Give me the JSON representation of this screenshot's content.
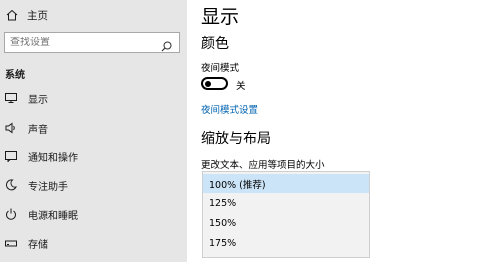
{
  "sidebar": {
    "home_label": "主页",
    "search_placeholder": "查找设置",
    "section_label": "系统",
    "items": [
      {
        "label": "显示",
        "icon": "monitor-icon"
      },
      {
        "label": "声音",
        "icon": "speaker-icon"
      },
      {
        "label": "通知和操作",
        "icon": "notification-icon"
      },
      {
        "label": "专注助手",
        "icon": "moon-icon"
      },
      {
        "label": "电源和睡眠",
        "icon": "power-icon"
      },
      {
        "label": "存储",
        "icon": "storage-icon"
      }
    ]
  },
  "main": {
    "title": "显示",
    "color_heading": "颜色",
    "night_light_label": "夜间模式",
    "night_light_state": "关",
    "night_light_link": "夜间模式设置",
    "scale_heading": "缩放与布局",
    "scale_label": "更改文本、应用等项目的大小",
    "scale_options": [
      "100% (推荐)",
      "125%",
      "150%",
      "175%"
    ],
    "scale_selected_index": 0
  },
  "colors": {
    "sidebar_bg": "#e6e6e6",
    "link": "#0063b1",
    "selected_option": "#cce4f7"
  }
}
